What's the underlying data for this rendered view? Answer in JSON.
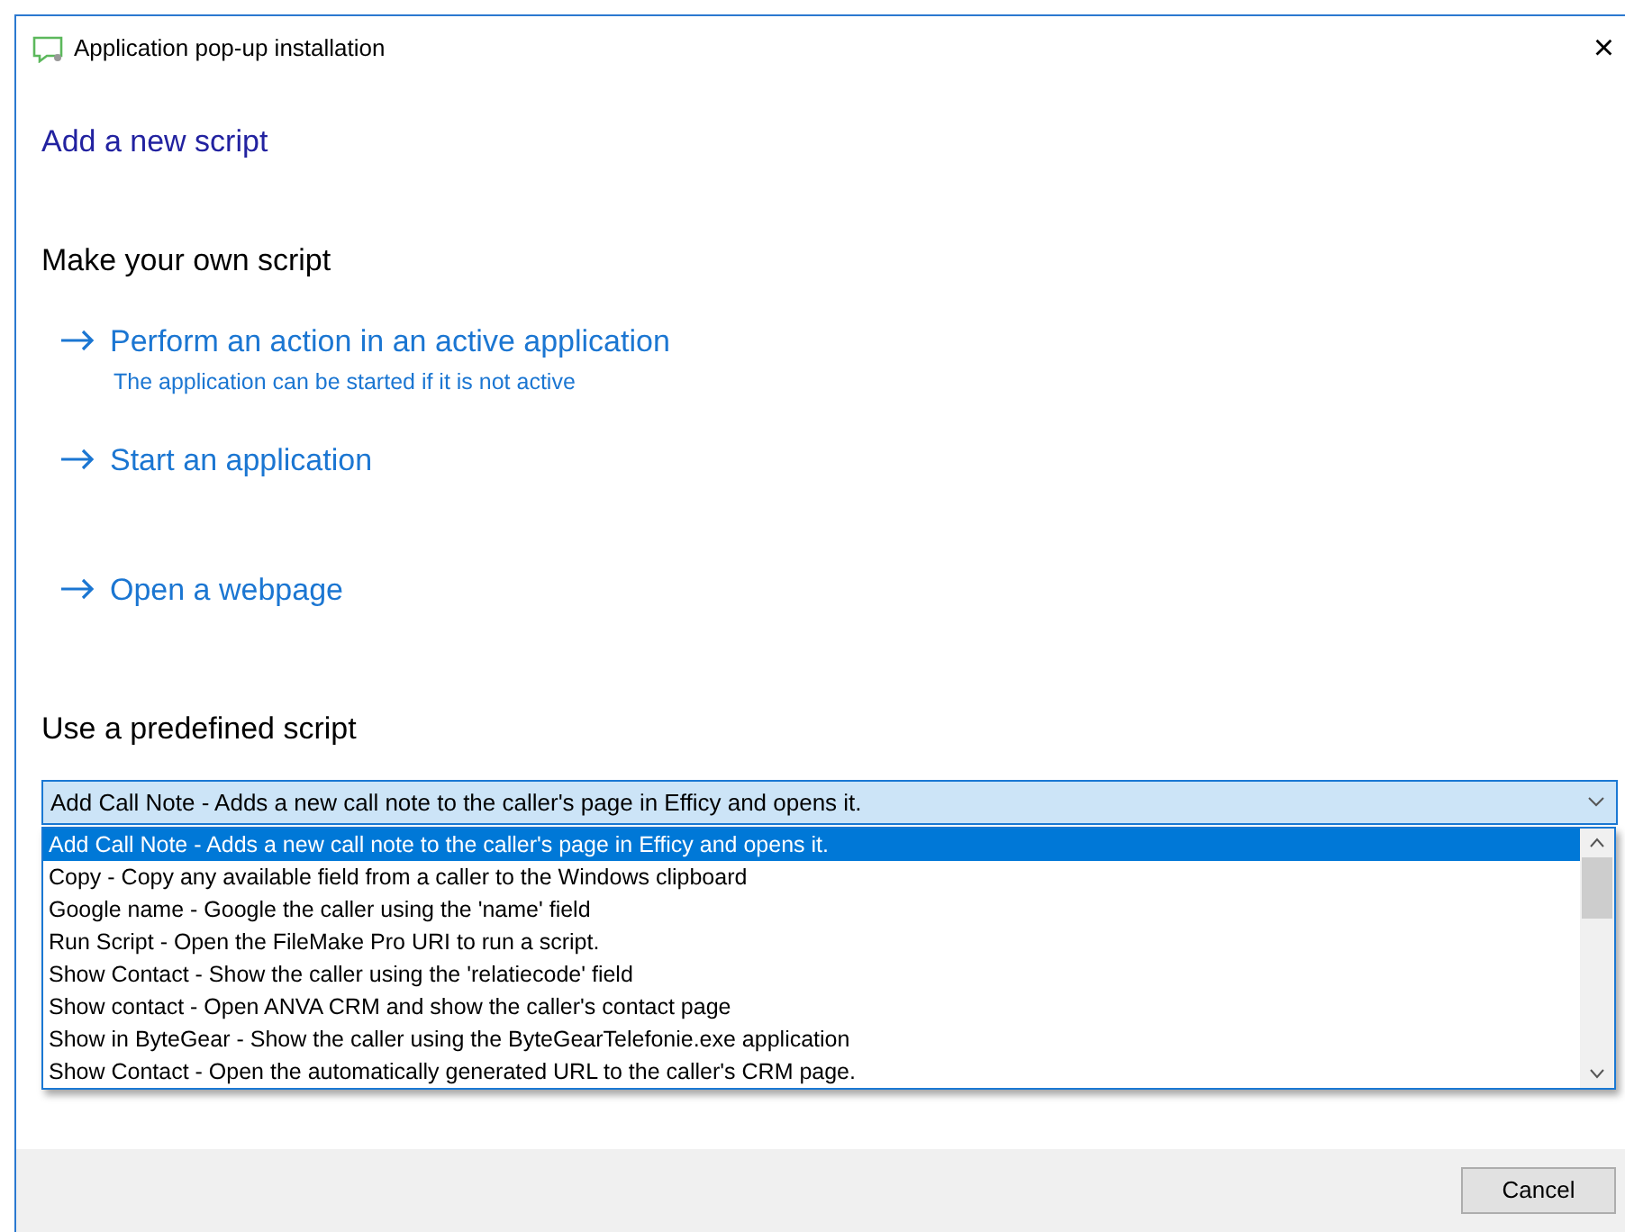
{
  "window": {
    "title": "Application pop-up installation",
    "close": "×"
  },
  "heading": "Add a new script",
  "own_script": {
    "title": "Make your own script",
    "actions": [
      {
        "label": "Perform an action in an active application",
        "note": "The application can be started if it is not active"
      },
      {
        "label": "Start an application"
      },
      {
        "label": "Open a webpage"
      }
    ]
  },
  "predefined": {
    "title": "Use a predefined script",
    "value": "Add Call Note - Adds a new call note to the caller's page in Efficy and opens it.",
    "expanded": true,
    "options": [
      {
        "label": "Add Call Note - Adds a new call note to the caller's page in Efficy and opens it.",
        "selected": true
      },
      {
        "label": "Copy - Copy any available field from a caller to the Windows clipboard",
        "selected": false
      },
      {
        "label": "Google name - Google the caller using the 'name' field",
        "selected": false
      },
      {
        "label": "Run Script - Open the FileMake Pro URI to run a script.",
        "selected": false
      },
      {
        "label": "Show Contact - Show the caller using the 'relatiecode' field",
        "selected": false
      },
      {
        "label": "Show contact - Open ANVA CRM and show the caller's contact page",
        "selected": false
      },
      {
        "label": "Show in ByteGear - Show the caller using the ByteGearTelefonie.exe application",
        "selected": false
      },
      {
        "label": "Show Contact - Open the automatically generated URL to the caller's CRM page.",
        "selected": false
      }
    ]
  },
  "buttons": [
    "Cancel"
  ]
}
